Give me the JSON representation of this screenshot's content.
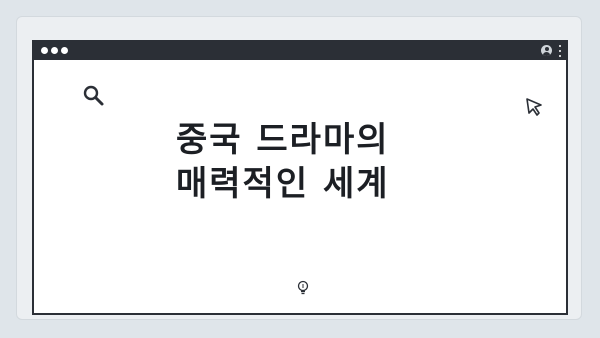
{
  "headline": {
    "line1": "중국 드라마의",
    "line2": "매력적인 세계"
  },
  "icons": {
    "search": "search-icon",
    "cursor": "cursor-arrow-icon",
    "bulb": "lightbulb-icon",
    "user": "user-icon",
    "menu": "kebab-menu-icon"
  },
  "colors": {
    "background": "#dfe5ea",
    "window_border": "#2b2f36",
    "window_body": "#ffffff",
    "text": "#1c1f24"
  }
}
